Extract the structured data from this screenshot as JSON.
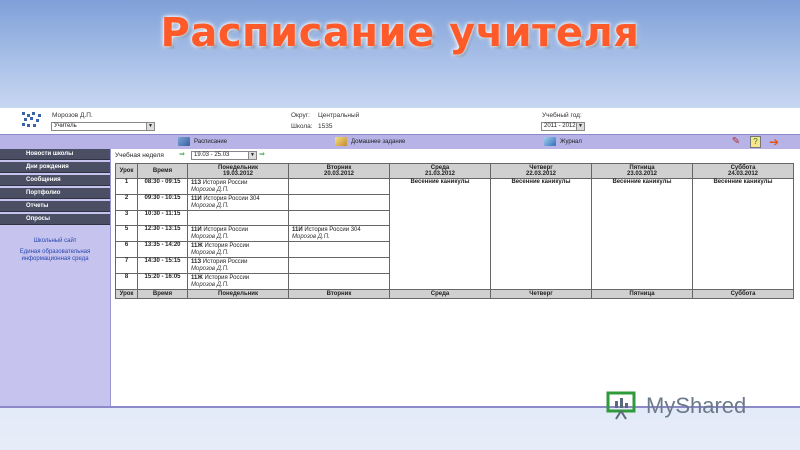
{
  "slide_title": "Расписание учителя",
  "top": {
    "user_name": "Морозов Д.П.",
    "role_value": "Учитель",
    "district_label": "Округ:",
    "district_value": "Центральный",
    "school_label": "Школа:",
    "school_value": "1535",
    "year_label": "Учебный год:",
    "year_value": "2011 - 2012"
  },
  "nav": {
    "schedule": "Расписание",
    "homework": "Домашнее задание",
    "journal": "Журнал"
  },
  "sidebar": {
    "items": [
      "Новости школы",
      "Дни рождения",
      "Сообщения",
      "Портфолио",
      "Отчеты",
      "Опросы"
    ],
    "links": [
      "Школьный сайт",
      "Единая образовательная информационная среда"
    ]
  },
  "week": {
    "label": "Учебная неделя",
    "value": "19.03 - 25.03"
  },
  "table": {
    "headers": {
      "lesson": "Урок",
      "time": "Время",
      "days": [
        {
          "name": "Понедельник",
          "date": "19.03.2012"
        },
        {
          "name": "Вторник",
          "date": "20.03.2012"
        },
        {
          "name": "Среда",
          "date": "21.03.2012"
        },
        {
          "name": "Четверг",
          "date": "22.03.2012"
        },
        {
          "name": "Пятница",
          "date": "23.03.2012"
        },
        {
          "name": "Суббота",
          "date": "24.03.2012"
        }
      ]
    },
    "holiday_text": "Весенние каникулы",
    "rows": [
      {
        "num": "1",
        "time": "08:30 - 09:15",
        "mon": {
          "cls": "11З",
          "subject": "История России",
          "room": "",
          "teacher": "Морозов Д.П."
        },
        "tue": null
      },
      {
        "num": "2",
        "time": "09:30 - 10:15",
        "mon": {
          "cls": "11И",
          "subject": "История России",
          "room": "304",
          "teacher": "Морозов Д.П."
        },
        "tue": null
      },
      {
        "num": "3",
        "time": "10:30 - 11:15",
        "mon": null,
        "tue": null
      },
      {
        "num": "5",
        "time": "12:30 - 13:15",
        "mon": {
          "cls": "11И",
          "subject": "История России",
          "room": "",
          "teacher": "Морозов Д.П."
        },
        "tue": {
          "cls": "11И",
          "subject": "История России",
          "room": "304",
          "teacher": "Морозов Д.П."
        }
      },
      {
        "num": "6",
        "time": "13:35 - 14:20",
        "mon": {
          "cls": "11Ж",
          "subject": "История России",
          "room": "",
          "teacher": "Морозов Д.П."
        },
        "tue": null
      },
      {
        "num": "7",
        "time": "14:30 - 15:15",
        "mon": {
          "cls": "11З",
          "subject": "История России",
          "room": "",
          "teacher": "Морозов Д.П."
        },
        "tue": null
      },
      {
        "num": "8",
        "time": "15:20 - 16:05",
        "mon": {
          "cls": "11Ж",
          "subject": "История России",
          "room": "",
          "teacher": "Морозов Д.П."
        },
        "tue": null
      }
    ]
  },
  "watermark": "MyShared"
}
